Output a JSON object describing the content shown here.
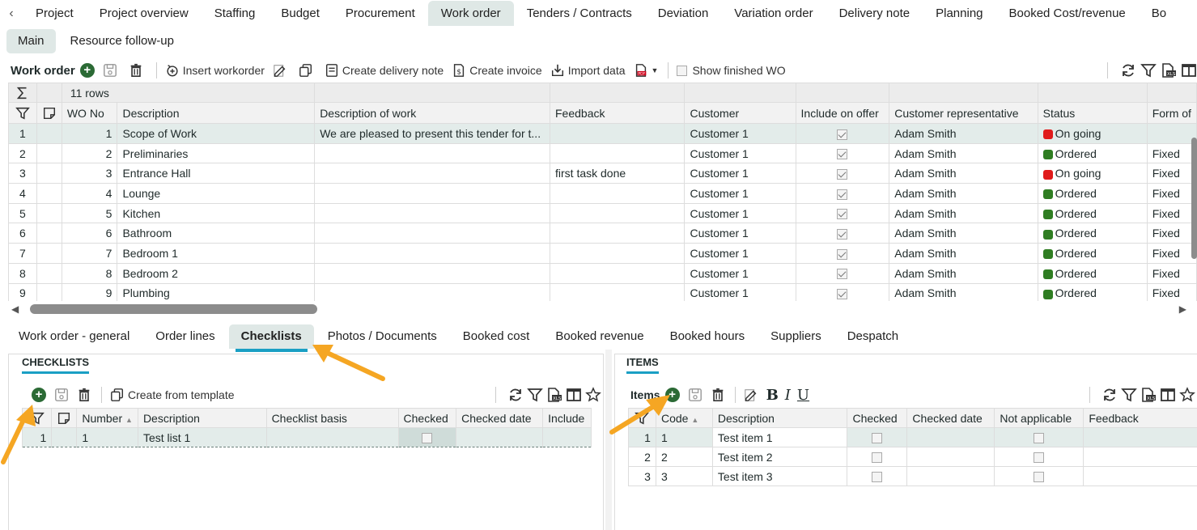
{
  "top_tabs": [
    "Project",
    "Project overview",
    "Staffing",
    "Budget",
    "Procurement",
    "Work order",
    "Tenders / Contracts",
    "Deviation",
    "Variation order",
    "Delivery note",
    "Planning",
    "Booked Cost/revenue",
    "Bo"
  ],
  "sub_tabs": [
    "Main",
    "Resource follow-up"
  ],
  "toolbar": {
    "title": "Work order",
    "insert_workorder": "Insert workorder",
    "create_delivery_note": "Create delivery note",
    "create_invoice": "Create invoice",
    "import_data": "Import data",
    "show_finished": "Show finished WO"
  },
  "grid": {
    "row_count": "11 rows",
    "columns": [
      "WO No",
      "Description",
      "Description of work",
      "Feedback",
      "Customer",
      "Include on offer",
      "Customer representative",
      "Status",
      "Form of"
    ],
    "rows": [
      {
        "idx": "1",
        "wo": "1",
        "desc": "Scope of Work",
        "dow": "We are pleased to present this tender for t...",
        "feedback": "",
        "customer": "Customer 1",
        "include": true,
        "rep": "Adam Smith",
        "status": "On going",
        "status_color": "#e01b1b",
        "form": ""
      },
      {
        "idx": "2",
        "wo": "2",
        "desc": "Preliminaries",
        "dow": "",
        "feedback": "",
        "customer": "Customer 1",
        "include": true,
        "rep": "Adam Smith",
        "status": "Ordered",
        "status_color": "#2f7d22",
        "form": "Fixed"
      },
      {
        "idx": "3",
        "wo": "3",
        "desc": "Entrance Hall",
        "dow": "",
        "feedback": "first task done",
        "customer": "Customer 1",
        "include": true,
        "rep": "Adam Smith",
        "status": "On going",
        "status_color": "#e01b1b",
        "form": "Fixed"
      },
      {
        "idx": "4",
        "wo": "4",
        "desc": "Lounge",
        "dow": "",
        "feedback": "",
        "customer": "Customer 1",
        "include": true,
        "rep": "Adam Smith",
        "status": "Ordered",
        "status_color": "#2f7d22",
        "form": "Fixed"
      },
      {
        "idx": "5",
        "wo": "5",
        "desc": "Kitchen",
        "dow": "",
        "feedback": "",
        "customer": "Customer 1",
        "include": true,
        "rep": "Adam Smith",
        "status": "Ordered",
        "status_color": "#2f7d22",
        "form": "Fixed"
      },
      {
        "idx": "6",
        "wo": "6",
        "desc": "Bathroom",
        "dow": "",
        "feedback": "",
        "customer": "Customer 1",
        "include": true,
        "rep": "Adam Smith",
        "status": "Ordered",
        "status_color": "#2f7d22",
        "form": "Fixed"
      },
      {
        "idx": "7",
        "wo": "7",
        "desc": "Bedroom 1",
        "dow": "",
        "feedback": "",
        "customer": "Customer 1",
        "include": true,
        "rep": "Adam Smith",
        "status": "Ordered",
        "status_color": "#2f7d22",
        "form": "Fixed"
      },
      {
        "idx": "8",
        "wo": "8",
        "desc": "Bedroom 2",
        "dow": "",
        "feedback": "",
        "customer": "Customer 1",
        "include": true,
        "rep": "Adam Smith",
        "status": "Ordered",
        "status_color": "#2f7d22",
        "form": "Fixed"
      },
      {
        "idx": "9",
        "wo": "9",
        "desc": "Plumbing",
        "dow": "",
        "feedback": "",
        "customer": "Customer 1",
        "include": true,
        "rep": "Adam Smith",
        "status": "Ordered",
        "status_color": "#2f7d22",
        "form": "Fixed"
      }
    ]
  },
  "lower_tabs": [
    "Work order - general",
    "Order lines",
    "Checklists",
    "Photos / Documents",
    "Booked cost",
    "Booked revenue",
    "Booked hours",
    "Suppliers",
    "Despatch"
  ],
  "checklists": {
    "title": "CHECKLISTS",
    "create_from_template": "Create from template",
    "columns": [
      "Number",
      "Description",
      "Checklist basis",
      "Checked",
      "Checked date",
      "Include"
    ],
    "rows": [
      {
        "idx": "1",
        "number": "1",
        "desc": "Test list 1",
        "basis": "",
        "checked": false,
        "date": ""
      }
    ]
  },
  "items": {
    "title": "ITEMS",
    "toolbar_title": "Items",
    "columns": [
      "Code",
      "Description",
      "Checked",
      "Checked date",
      "Not applicable",
      "Feedback"
    ],
    "rows": [
      {
        "idx": "1",
        "code": "1",
        "desc": "Test item 1"
      },
      {
        "idx": "2",
        "code": "2",
        "desc": "Test item 2"
      },
      {
        "idx": "3",
        "code": "3",
        "desc": "Test item 3"
      }
    ]
  },
  "colors": {
    "accent": "#1a9fc4",
    "active_tab": "#dfe8e6",
    "arrow": "#f5a623",
    "add_green": "#2b6a35"
  }
}
